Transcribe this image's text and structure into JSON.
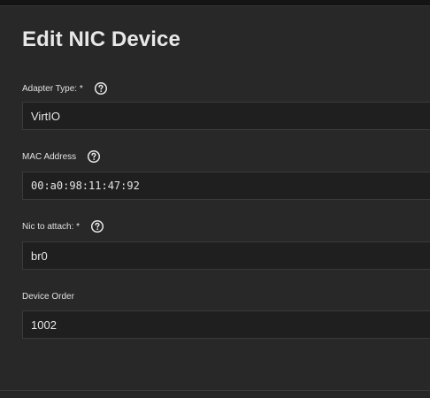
{
  "dialog": {
    "title": "Edit NIC Device"
  },
  "fields": {
    "adapter_type": {
      "label": "Adapter Type: *",
      "value": "VirtIO",
      "icon": "help-circle-icon"
    },
    "mac_address": {
      "label": "MAC Address",
      "value": "00:a0:98:11:47:92",
      "icon": "help-circle-icon"
    },
    "nic_to_attach": {
      "label": "Nic to attach: *",
      "value": "br0",
      "icon": "help-circle-icon"
    },
    "device_order": {
      "label": "Device Order",
      "value": "1002"
    }
  },
  "colors": {
    "background": "#282828",
    "input_background": "#1f1f1f",
    "text": "#e2e2e2"
  }
}
